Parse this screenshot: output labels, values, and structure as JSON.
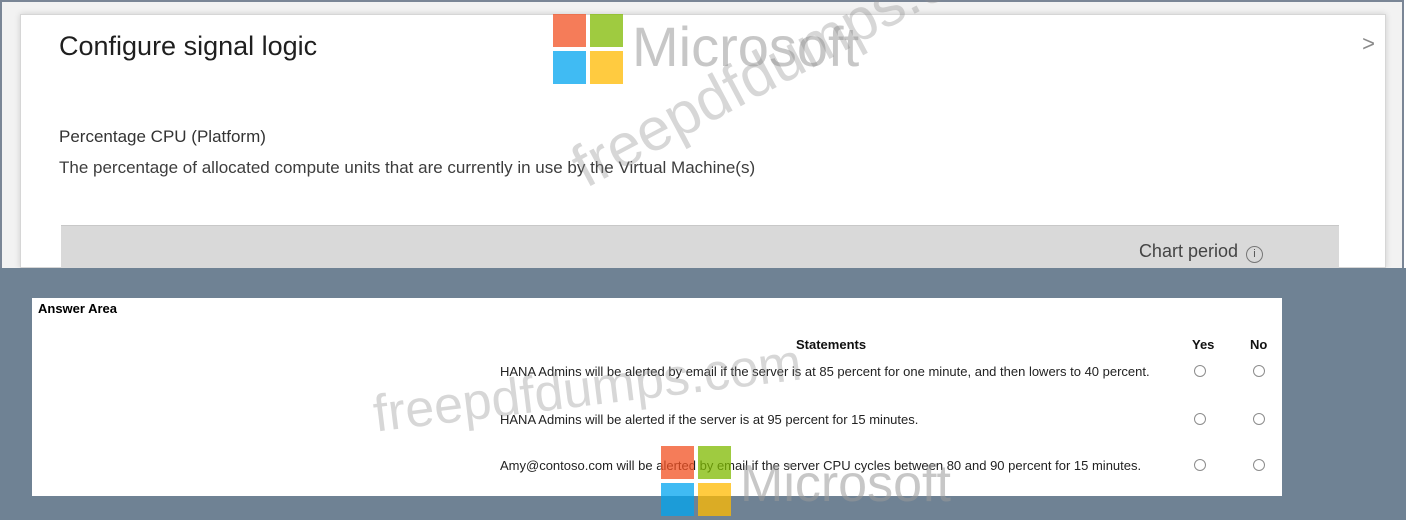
{
  "blade": {
    "title": "Configure signal logic",
    "chevron": ">",
    "metric_name": "Percentage CPU (Platform)",
    "metric_description": "The percentage of allocated compute units that are currently in use by the Virtual Machine(s)",
    "chart_period_label": "Chart period",
    "info_icon": "i"
  },
  "answer_area": {
    "title": "Answer Area",
    "headers": {
      "statements": "Statements",
      "yes": "Yes",
      "no": "No"
    },
    "rows": [
      {
        "statement": "HANA Admins will be alerted by email if the server is at 85 percent for one minute, and then lowers to 40 percent."
      },
      {
        "statement": "HANA Admins will be alerted if the server is at 95 percent for 15 minutes."
      },
      {
        "statement": "Amy@contoso.com will be alerted by email if the server CPU cycles between 80 and 90 percent for 15 minutes."
      }
    ]
  },
  "watermarks": {
    "brand": "Microsoft",
    "site_top": "freepdfdumps.com",
    "site_bottom": "freepdfdumps.com"
  },
  "colors": {
    "frame": "#6f8294",
    "logo_red": "#f25022",
    "logo_green": "#7fba00",
    "logo_blue": "#00a4ef",
    "logo_yellow": "#ffb900"
  }
}
